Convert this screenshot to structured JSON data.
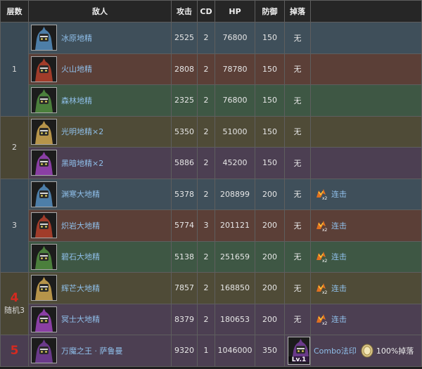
{
  "headers": [
    "层数",
    "敌人",
    "攻击",
    "CD",
    "HP",
    "防御",
    "掉落",
    ""
  ],
  "floors": [
    {
      "label": "1"
    },
    {
      "label": "2"
    },
    {
      "label": "3"
    },
    {
      "big": "4",
      "sub": "随机3"
    },
    {
      "big": "5"
    }
  ],
  "rows": [
    {
      "name": "冰原地精",
      "atk": "2525",
      "cd": "2",
      "hp": "76800",
      "def": "150",
      "drop": "无",
      "color": "#3f4f5a",
      "portrait": "blue"
    },
    {
      "name": "火山地精",
      "atk": "2808",
      "cd": "2",
      "hp": "78780",
      "def": "150",
      "drop": "无",
      "color": "#5b3f37",
      "portrait": "red"
    },
    {
      "name": "森林地精",
      "atk": "2325",
      "cd": "2",
      "hp": "76800",
      "def": "150",
      "drop": "无",
      "color": "#3e5744",
      "portrait": "green"
    },
    {
      "name": "光明地精×2",
      "atk": "5350",
      "cd": "2",
      "hp": "51000",
      "def": "150",
      "drop": "无",
      "color": "#4f4b37",
      "portrait": "gold"
    },
    {
      "name": "黑暗地精×2",
      "atk": "5886",
      "cd": "2",
      "hp": "45200",
      "def": "150",
      "drop": "无",
      "color": "#4c3f52",
      "portrait": "purple"
    },
    {
      "name": "渊寒大地精",
      "atk": "5378",
      "cd": "2",
      "hp": "208899",
      "def": "200",
      "drop": "无",
      "skill": "连击",
      "color": "#3f4f5a",
      "portrait": "blue"
    },
    {
      "name": "炽岩大地精",
      "atk": "5774",
      "cd": "3",
      "hp": "201121",
      "def": "200",
      "drop": "无",
      "skill": "连击",
      "color": "#5b3f37",
      "portrait": "red"
    },
    {
      "name": "碧石大地精",
      "atk": "5138",
      "cd": "2",
      "hp": "251659",
      "def": "200",
      "drop": "无",
      "skill": "连击",
      "color": "#3e5744",
      "portrait": "green"
    },
    {
      "name": "辉芒大地精",
      "atk": "7857",
      "cd": "2",
      "hp": "168850",
      "def": "200",
      "drop": "无",
      "skill": "连击",
      "color": "#4f4b37",
      "portrait": "gold"
    },
    {
      "name": "冥士大地精",
      "atk": "8379",
      "cd": "2",
      "hp": "180653",
      "def": "200",
      "drop": "无",
      "skill": "连击",
      "color": "#4c3f52",
      "portrait": "purple"
    },
    {
      "name": "万魔之王 · 萨鲁曼",
      "atk": "9320",
      "cd": "1",
      "hp": "1046000",
      "def": "350",
      "color": "#4c3f52",
      "portrait": "boss"
    }
  ],
  "boss_extra": {
    "drop_level": "Lv.1",
    "combo": "Combo法印",
    "drop_rate": "100%掉落"
  },
  "portrait_colors": {
    "blue": "#4d7ea8",
    "red": "#a13c2a",
    "green": "#4b7f3c",
    "gold": "#b6944a",
    "purple": "#8a3fa4",
    "boss": "#6a3a8a"
  },
  "icons": {
    "skill": "combo-x2-icon",
    "coin": "coin-icon"
  }
}
